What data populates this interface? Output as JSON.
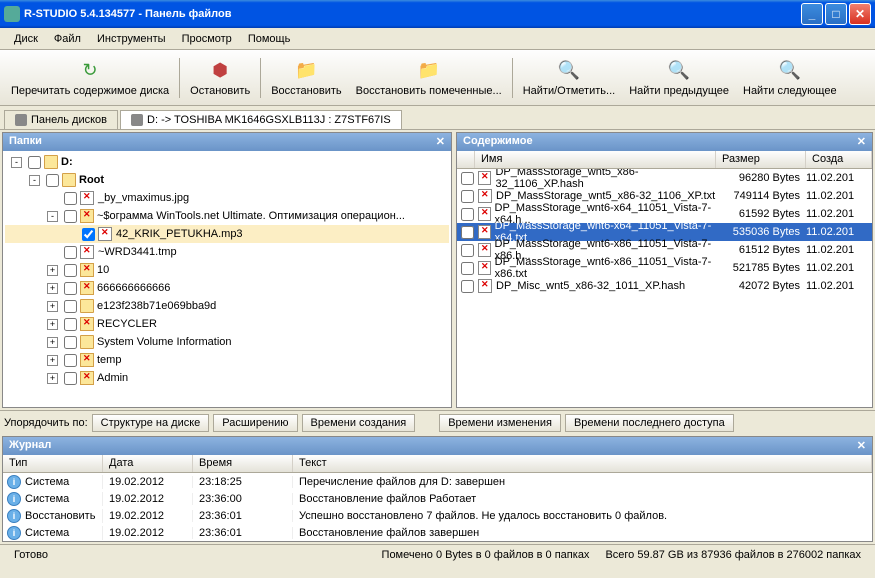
{
  "window": {
    "title": "R-STUDIO 5.4.134577 - Панель файлов"
  },
  "menu": [
    "Диск",
    "Файл",
    "Инструменты",
    "Просмотр",
    "Помощь"
  ],
  "toolbar": [
    {
      "icon": "↻",
      "label": "Перечитать содержимое диска",
      "color": "#3a9a3a"
    },
    {
      "icon": "⬢",
      "label": "Остановить",
      "color": "#c04040"
    },
    {
      "icon": "📁",
      "label": "Восстановить",
      "color": "#d4a048"
    },
    {
      "icon": "📁",
      "label": "Восстановить помеченные...",
      "color": "#d4a048"
    },
    {
      "icon": "🔍",
      "label": "Найти/Отметить...",
      "color": "#888"
    },
    {
      "icon": "🔍",
      "label": "Найти предыдущее",
      "color": "#888"
    },
    {
      "icon": "🔍",
      "label": "Найти следующее",
      "color": "#888"
    }
  ],
  "tabs": [
    {
      "label": "Панель дисков",
      "active": false
    },
    {
      "label": "D: -> TOSHIBA MK1646GSXLB113J : Z7STF67IS",
      "active": true
    }
  ],
  "left": {
    "title": "Папки",
    "tree": [
      {
        "indent": 0,
        "exp": "-",
        "chk": false,
        "icon": "drive",
        "label": "D:",
        "bold": true
      },
      {
        "indent": 1,
        "exp": "-",
        "chk": false,
        "icon": "folder",
        "label": "Root",
        "bold": true
      },
      {
        "indent": 2,
        "exp": "",
        "chk": false,
        "icon": "filex",
        "label": "_by_vmaximus.jpg"
      },
      {
        "indent": 2,
        "exp": "-",
        "chk": false,
        "icon": "folderx",
        "label": "~$ограмма WinTools.net Ultimate. Оптимизация операцион..."
      },
      {
        "indent": 3,
        "exp": "",
        "chk": true,
        "icon": "filex",
        "label": "42_KRIK_PETUKHA.mp3",
        "sel": true
      },
      {
        "indent": 2,
        "exp": "",
        "chk": false,
        "icon": "filex",
        "label": "~WRD3441.tmp"
      },
      {
        "indent": 2,
        "exp": "+",
        "chk": false,
        "icon": "folderx",
        "label": "10"
      },
      {
        "indent": 2,
        "exp": "+",
        "chk": false,
        "icon": "folderx",
        "label": "666666666666"
      },
      {
        "indent": 2,
        "exp": "+",
        "chk": false,
        "icon": "folder",
        "label": "e123f238b71e069bba9d"
      },
      {
        "indent": 2,
        "exp": "+",
        "chk": false,
        "icon": "folderx",
        "label": "RECYCLER"
      },
      {
        "indent": 2,
        "exp": "+",
        "chk": false,
        "icon": "folder",
        "label": "System Volume Information"
      },
      {
        "indent": 2,
        "exp": "+",
        "chk": false,
        "icon": "folderx",
        "label": "temp"
      },
      {
        "indent": 2,
        "exp": "+",
        "chk": false,
        "icon": "folderx",
        "label": "Admin"
      }
    ]
  },
  "right": {
    "title": "Содержимое",
    "cols": [
      "Имя",
      "Размер",
      "Созда"
    ],
    "rows": [
      {
        "name": "DP_MassStorage_wnt5_x86-32_1106_XP.hash",
        "size": "96280 Bytes",
        "date": "11.02.201"
      },
      {
        "name": "DP_MassStorage_wnt5_x86-32_1106_XP.txt",
        "size": "749114 Bytes",
        "date": "11.02.201"
      },
      {
        "name": "DP_MassStorage_wnt6-x64_11051_Vista-7-x64.h...",
        "size": "61592 Bytes",
        "date": "11.02.201"
      },
      {
        "name": "DP_MassStorage_wnt6-x64_11051_Vista-7-x64.txt",
        "size": "535036 Bytes",
        "date": "11.02.201",
        "sel": true
      },
      {
        "name": "DP_MassStorage_wnt6-x86_11051_Vista-7-x86.h...",
        "size": "61512 Bytes",
        "date": "11.02.201"
      },
      {
        "name": "DP_MassStorage_wnt6-x86_11051_Vista-7-x86.txt",
        "size": "521785 Bytes",
        "date": "11.02.201"
      },
      {
        "name": "DP_Misc_wnt5_x86-32_1011_XP.hash",
        "size": "42072 Bytes",
        "date": "11.02.201"
      }
    ]
  },
  "sort": {
    "label": "Упорядочить по:",
    "left": [
      "Структуре на диске",
      "Расширению",
      "Времени создания"
    ],
    "right": [
      "Времени изменения",
      "Времени последнего доступа"
    ]
  },
  "journal": {
    "title": "Журнал",
    "cols": [
      "Тип",
      "Дата",
      "Время",
      "Текст"
    ],
    "rows": [
      {
        "type": "Система",
        "date": "19.02.2012",
        "time": "23:18:25",
        "text": "Перечисление файлов для D: завершен"
      },
      {
        "type": "Система",
        "date": "19.02.2012",
        "time": "23:36:00",
        "text": "Восстановление файлов Работает"
      },
      {
        "type": "Восстановить",
        "date": "19.02.2012",
        "time": "23:36:01",
        "text": "Успешно восстановлено 7 файлов. Не удалось восстановить 0 файлов."
      },
      {
        "type": "Система",
        "date": "19.02.2012",
        "time": "23:36:01",
        "text": "Восстановление файлов завершен"
      }
    ]
  },
  "status": {
    "left": "Готово",
    "mid": "Помечено 0 Bytes в 0 файлов в 0 папках",
    "right": "Всего 59.87 GB из 87936 файлов в 276002 папках"
  }
}
